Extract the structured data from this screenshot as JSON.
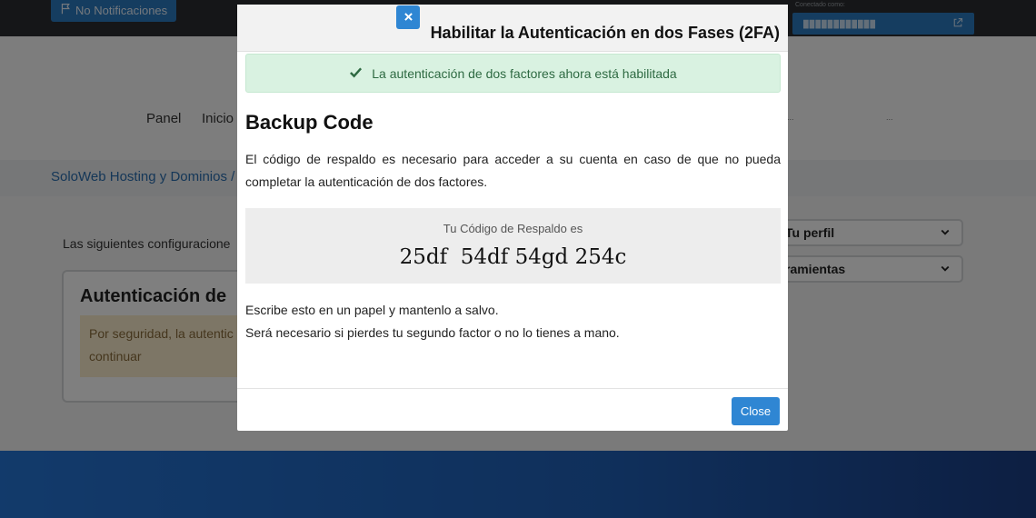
{
  "topbar": {
    "notifications_label": "No Notificaciones",
    "logged_in_label": "Conectado como:",
    "account_name": "████████████"
  },
  "nav": {
    "panel": "Panel",
    "inicio": "Inicio",
    "faded_item": "...",
    "user_menu": "..."
  },
  "breadcrumb": {
    "home": "SoloWeb Hosting y Dominios",
    "separator": "/"
  },
  "page": {
    "intro_text": "Las siguientes configuracione",
    "card_title": "Autenticación de",
    "card_warning": "Por seguridad, la autentic para continuar",
    "side_panel_1": "Tu perfil",
    "side_panel_2": "ramientas"
  },
  "modal": {
    "title": "Habilitar la Autenticación en dos Fases (2FA)",
    "success_message": "La autenticación de dos factores ahora está habilitada",
    "backup_heading": "Backup Code",
    "backup_description": "El código de respaldo es necesario para acceder a su cuenta en caso de que no pueda completar la autenticación de dos factores.",
    "code_label": "Tu Código de Respaldo es",
    "code_value": "25df  54df 54gd 254c",
    "note_1": "Escribe esto en un papel y mantenlo a salvo.",
    "note_2": "Será necesario si pierdes tu segundo factor o no lo tienes a mano.",
    "close_label": "Close"
  },
  "colors": {
    "primary": "#2f86d3",
    "success_bg": "#d9f2e1",
    "success_text": "#2e6a42",
    "warning_bg": "#fbeccd"
  },
  "icons": [
    "flag-icon",
    "external-link-icon",
    "close-icon",
    "check-icon",
    "chevron-down-icon"
  ]
}
